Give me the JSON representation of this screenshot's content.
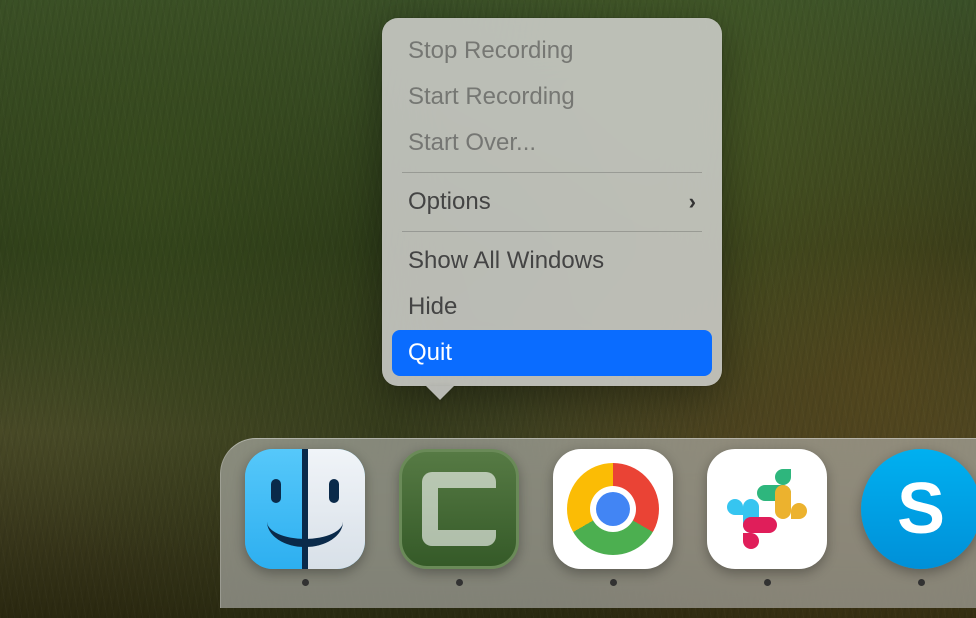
{
  "context_menu": {
    "items": [
      {
        "label": "Stop Recording",
        "disabled": true
      },
      {
        "label": "Start Recording",
        "disabled": true
      },
      {
        "label": "Start Over...",
        "disabled": true
      }
    ],
    "options_label": "Options",
    "window_items": [
      {
        "label": "Show All Windows"
      },
      {
        "label": "Hide"
      }
    ],
    "quit_label": "Quit",
    "highlighted": "Quit"
  },
  "dock": {
    "apps": [
      {
        "name": "Finder",
        "icon": "finder-icon",
        "running": true
      },
      {
        "name": "Camtasia",
        "icon": "camtasia-icon",
        "running": true
      },
      {
        "name": "Google Chrome",
        "icon": "chrome-icon",
        "running": true
      },
      {
        "name": "Slack",
        "icon": "slack-icon",
        "running": true
      },
      {
        "name": "Skype",
        "icon": "skype-icon",
        "running": true
      }
    ]
  }
}
